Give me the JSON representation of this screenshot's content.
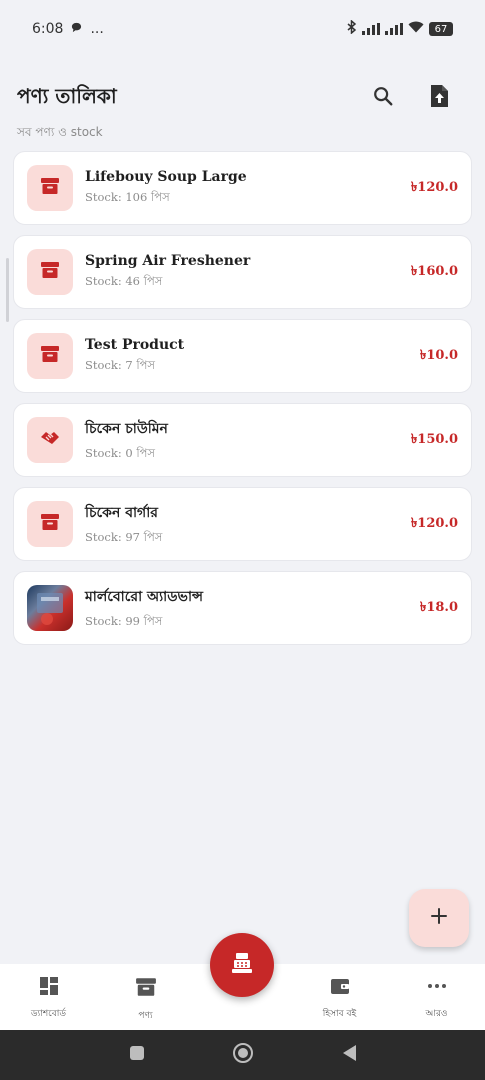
{
  "status_bar": {
    "time": "6:08",
    "more": "...",
    "battery": "67"
  },
  "header": {
    "title": "পণ্য তালিকা",
    "subtitle": "সব পণ্য ও stock"
  },
  "products": [
    {
      "name": "Lifebouy Soup Large",
      "stock": "Stock: 106 পিস",
      "price": "৳120.0",
      "icon": "archive-box-icon"
    },
    {
      "name": "Spring Air Freshener",
      "stock": "Stock: 46 পিস",
      "price": "৳160.0",
      "icon": "archive-box-icon"
    },
    {
      "name": "Test Product",
      "stock": "Stock: 7 পিস",
      "price": "৳10.0",
      "icon": "archive-box-icon"
    },
    {
      "name": "চিকেন চাউমিন",
      "stock": "Stock: 0 পিস",
      "price": "৳150.0",
      "icon": "handshake-icon"
    },
    {
      "name": "চিকেন বার্গার",
      "stock": "Stock: 97 পিস",
      "price": "৳120.0",
      "icon": "archive-box-icon"
    },
    {
      "name": "মার্লবোরো অ্যাডভান্স",
      "stock": "Stock: 99 পিস",
      "price": "৳18.0",
      "icon": "product-photo"
    }
  ],
  "bottom_nav": {
    "dashboard": "ড্যাশবোর্ড",
    "products": "পণ্য",
    "ledger": "হিসাব বই",
    "more": "আরও"
  },
  "colors": {
    "accent": "#c62828",
    "thumb_bg": "#fadcd9",
    "background": "#f1f2f6"
  }
}
